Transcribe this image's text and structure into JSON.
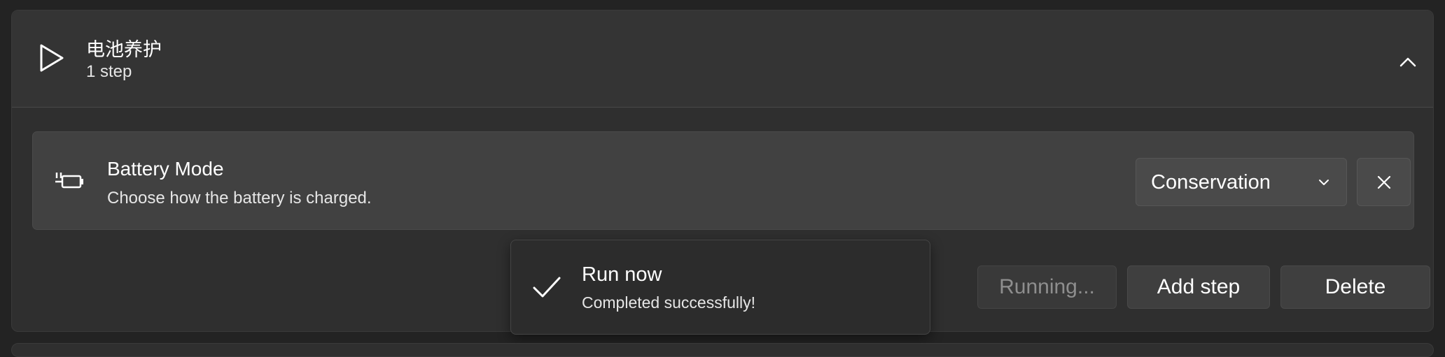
{
  "automation": {
    "title": "电池养护",
    "subtitle": "1 step",
    "icons": {
      "run": "play-icon",
      "collapse": "chevron-up-icon"
    }
  },
  "step": {
    "title": "Battery Mode",
    "description": "Choose how the battery is charged.",
    "icon": "battery-plug-icon",
    "selected_mode": "Conservation",
    "remove_icon": "close-icon"
  },
  "actions": {
    "running_label": "Running...",
    "add_step_label": "Add step",
    "delete_label": "Delete"
  },
  "toast": {
    "title": "Run now",
    "message": "Completed successfully!",
    "icon": "checkmark-icon"
  },
  "colors": {
    "background": "#232323",
    "card": "#2f2f2f",
    "step_row": "#414141",
    "button": "#3f3f3f",
    "disabled_text": "#8e8e8e"
  }
}
